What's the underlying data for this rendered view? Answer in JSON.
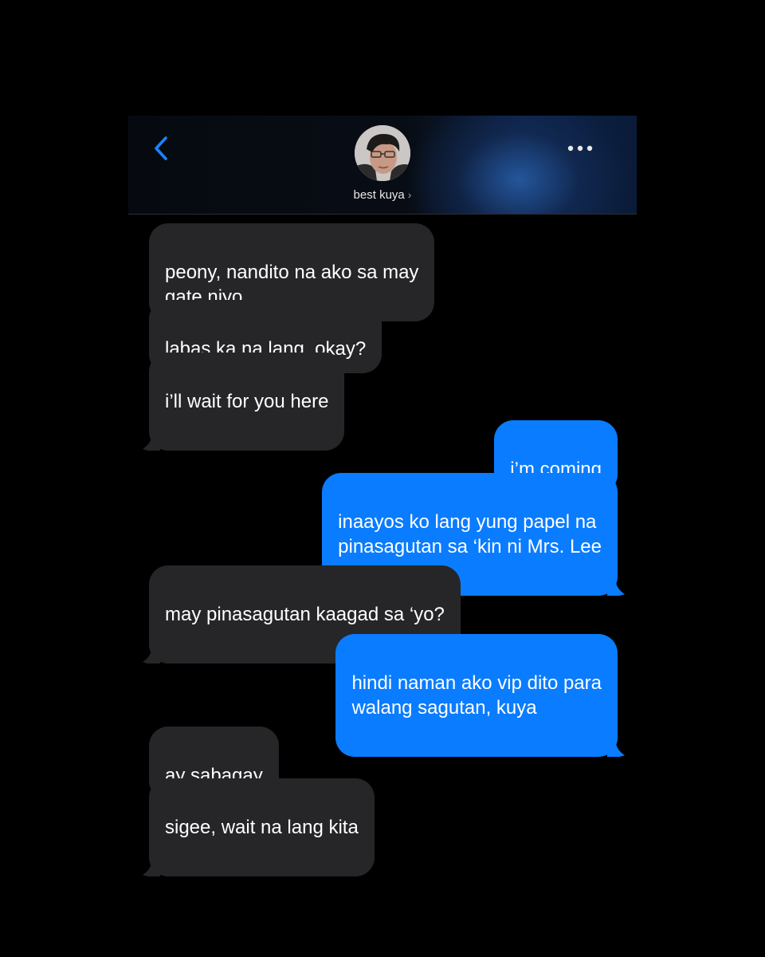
{
  "header": {
    "contact_name": "best kuya",
    "chevron": "›",
    "back_icon": "chevron-left-icon",
    "more_icon": "ellipsis-icon",
    "accent_color": "#1a82ff"
  },
  "messages": [
    {
      "direction": "incoming",
      "text": "peony, nandito na ako sa may\ngate niyo"
    },
    {
      "direction": "incoming",
      "text": "labas ka na lang, okay?"
    },
    {
      "direction": "incoming",
      "text": "i’ll wait for you here"
    },
    {
      "direction": "outgoing",
      "text": "i’m coming"
    },
    {
      "direction": "outgoing",
      "text": "inaayos ko lang yung papel na\npinasagutan sa ‘kin ni Mrs. Lee"
    },
    {
      "direction": "incoming",
      "text": "may pinasagutan kaagad sa ‘yo?"
    },
    {
      "direction": "outgoing",
      "text": "hindi naman ako vip dito para\nwalang sagutan, kuya"
    },
    {
      "direction": "incoming",
      "text": "ay sabagay"
    },
    {
      "direction": "incoming",
      "text": "sigee, wait na lang kita"
    }
  ],
  "colors": {
    "incoming_bubble": "#262628",
    "outgoing_bubble": "#0a7cff",
    "background": "#000000"
  }
}
